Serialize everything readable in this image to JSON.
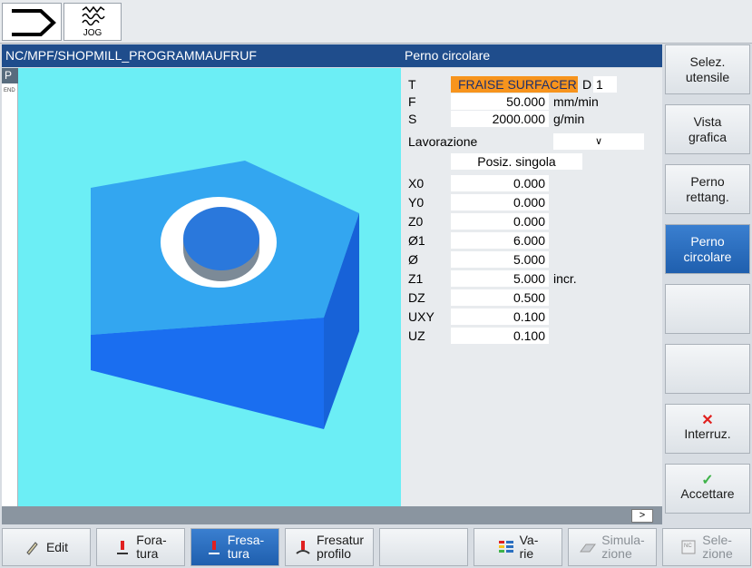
{
  "header": {
    "mode_icon": "program-arrow-icon",
    "jog_label": "JOG",
    "jog_icon": "jog-waves-icon"
  },
  "path_title": "NC/MPF/SHOPMILL_PROGRAMMAUFRUF",
  "cycle_title": "Perno circolare",
  "program_strip": {
    "p": "P",
    "end": "END"
  },
  "params": {
    "tool": {
      "label": "T",
      "value": "FRAISE SURFACER",
      "d_label": "D",
      "d_value": "1"
    },
    "feed": {
      "label": "F",
      "value": "50.000",
      "unit": "mm/min"
    },
    "speed": {
      "label": "S",
      "value": "2000.000",
      "unit": "g/min"
    },
    "lavorazione": {
      "label": "Lavorazione",
      "select_value": "∨"
    },
    "position_mode": "Posiz. singola",
    "rows": [
      {
        "label": "X0",
        "value": "0.000",
        "unit": ""
      },
      {
        "label": "Y0",
        "value": "0.000",
        "unit": ""
      },
      {
        "label": "Z0",
        "value": "0.000",
        "unit": ""
      },
      {
        "label": "Ø1",
        "value": "6.000",
        "unit": ""
      },
      {
        "label": "Ø",
        "value": "5.000",
        "unit": ""
      },
      {
        "label": "Z1",
        "value": "5.000",
        "unit": "incr."
      },
      {
        "label": "DZ",
        "value": "0.500",
        "unit": ""
      },
      {
        "label": "UXY",
        "value": "0.100",
        "unit": ""
      },
      {
        "label": "UZ",
        "value": "0.100",
        "unit": ""
      }
    ]
  },
  "vertical_softkeys": [
    {
      "line1": "Selez.",
      "line2": "utensile",
      "active": false
    },
    {
      "line1": "Vista",
      "line2": "grafica",
      "active": false
    },
    {
      "line1": "Perno",
      "line2": "rettang.",
      "active": false
    },
    {
      "line1": "Perno",
      "line2": "circolare",
      "active": true
    },
    {
      "line1": "",
      "line2": "",
      "active": false
    },
    {
      "line1": "",
      "line2": "",
      "active": false
    },
    {
      "line1": "Interruz.",
      "line2": "",
      "icon": "cross-icon",
      "active": false
    },
    {
      "line1": "Accettare",
      "line2": "",
      "icon": "checkmark-icon",
      "active": false
    }
  ],
  "more_button": ">",
  "horizontal_softkeys": [
    {
      "line1": "Edit",
      "line2": "",
      "icon": "edit-pencil-icon"
    },
    {
      "line1": "Fora-",
      "line2": "tura",
      "icon": "drill-icon"
    },
    {
      "line1": "Fresa-",
      "line2": "tura",
      "icon": "mill-icon",
      "active": true
    },
    {
      "line1": "Fresatur",
      "line2": "profilo",
      "icon": "contour-mill-icon"
    },
    {
      "line1": "",
      "line2": ""
    },
    {
      "line1": "Va-",
      "line2": "rie",
      "icon": "various-icon"
    },
    {
      "line1": "Simula-",
      "line2": "zione",
      "icon": "simulation-icon",
      "disabled": true
    },
    {
      "line1": "Sele-",
      "line2": "zione",
      "icon": "nc-select-icon",
      "disabled": true
    }
  ],
  "colors": {
    "title_bar": "#1f4d8c",
    "graphic_bg": "#6ceef5",
    "tool_highlight": "#f7941d",
    "active_key": "#2a6fc0",
    "block_top": "#33a6f0",
    "block_front": "#1a6ef0"
  }
}
